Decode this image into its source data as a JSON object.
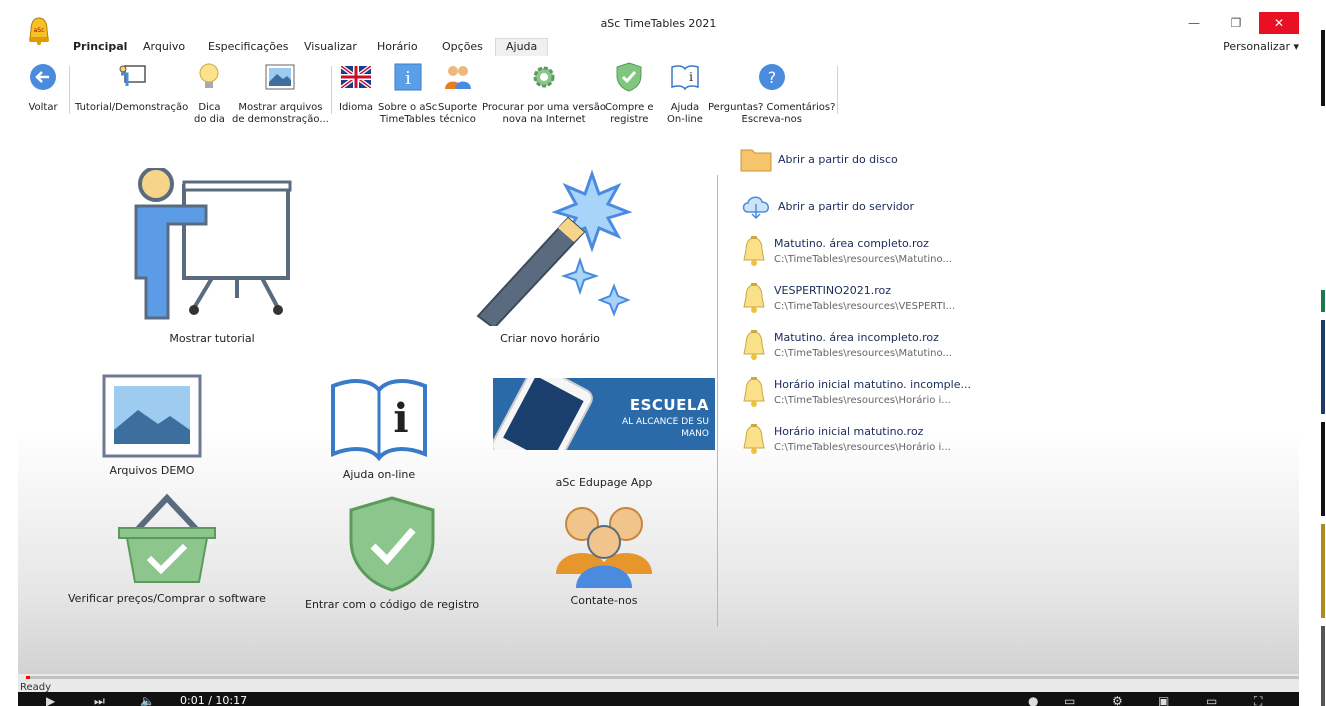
{
  "window": {
    "title": "aSc TimeTables 2021"
  },
  "tabs": [
    "Principal",
    "Arquivo",
    "Especificações",
    "Visualizar",
    "Horário",
    "Opções",
    "Ajuda"
  ],
  "personalize": "Personalizar",
  "ribbon": {
    "back": "Voltar",
    "tutorial": "Tutorial/Demonstração",
    "tip_1": "Dica",
    "tip_2": "do dia",
    "demo_1": "Mostrar arquivos",
    "demo_2": "de demonstração...",
    "language": "Idioma",
    "about_1": "Sobre o aSc",
    "about_2": "TimeTables",
    "support_1": "Suporte",
    "support_2": "técnico",
    "update_1": "Procurar por uma versão",
    "update_2": "nova na Internet",
    "buy_1": "Compre e",
    "buy_2": "registre",
    "help_1": "Ajuda",
    "help_2": "On-line",
    "questions_1": "Perguntas? Comentários?",
    "questions_2": "Escreva-nos"
  },
  "main": {
    "show_tutorial": "Mostrar tutorial",
    "new_timetable": "Criar novo horário",
    "demo_files": "Arquivos DEMO",
    "online_help": "Ajuda on-line",
    "edupage_app": "aSc Edupage App",
    "edupage_title": "ESCUELA",
    "edupage_sub_1": "AL ALCANCE DE SU",
    "edupage_sub_2": "MANO",
    "buy": "Verificar preços/Comprar o software",
    "register": "Entrar com o código de registro",
    "contact": "Contate-nos"
  },
  "recent": {
    "open_disk": "Abrir a partir do disco",
    "open_server": "Abrir a partir do servidor",
    "files": [
      {
        "name": "Matutino. área completo.roz",
        "path": "C:\\TimeTables\\resources\\Matutino..."
      },
      {
        "name": "VESPERTINO2021.roz",
        "path": "C:\\TimeTables\\resources\\VESPERTI..."
      },
      {
        "name": "Matutino. área incompleto.roz",
        "path": "C:\\TimeTables\\resources\\Matutino..."
      },
      {
        "name": "Horário inicial matutino. incomple...",
        "path": "C:\\TimeTables\\resources\\Horário i..."
      },
      {
        "name": "Horário inicial matutino.roz",
        "path": "C:\\TimeTables\\resources\\Horário i..."
      }
    ]
  },
  "status": {
    "ready": "Ready"
  },
  "player": {
    "time": "0:01 / 10:17",
    "progress": 0.002
  },
  "colors": {
    "accent": "#2a6aa8",
    "close": "#e81123",
    "progress": "#ff0000"
  }
}
